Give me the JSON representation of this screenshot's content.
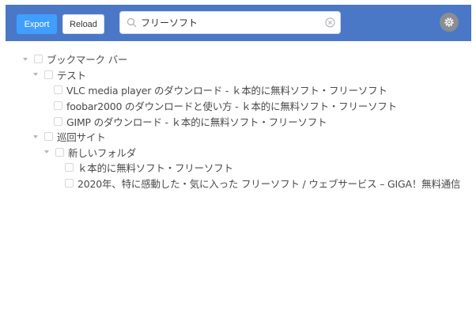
{
  "toolbar": {
    "export_label": "Export",
    "reload_label": "Reload",
    "settings_icon": "gear-icon",
    "header_color": "#4a78c6",
    "export_color": "#409eff"
  },
  "search": {
    "value": "フリーソフト",
    "placeholder": "",
    "search_icon": "search-icon",
    "clear_icon": "clear-icon"
  },
  "tree": {
    "root": {
      "label": "ブックマーク バー",
      "children": {
        "test": {
          "label": "テスト",
          "items": [
            "VLC media player のダウンロード - ｋ本的に無料ソフト・フリーソフト",
            "foobar2000 のダウンロードと使い方 - ｋ本的に無料ソフト・フリーソフト",
            "GIMP のダウンロード - ｋ本的に無料ソフト・フリーソフト"
          ]
        },
        "junkai": {
          "label": "巡回サイト",
          "children": {
            "new_folder": {
              "label": "新しいフォルダ",
              "items": [
                "ｋ本的に無料ソフト・フリーソフト",
                "2020年、特に感動した・気に入った フリーソフト / ウェブサービス – GIGA！無料通信"
              ]
            }
          }
        }
      }
    }
  }
}
